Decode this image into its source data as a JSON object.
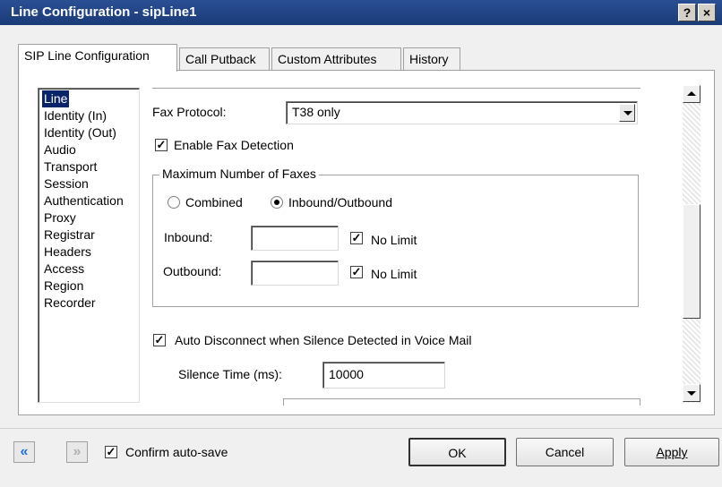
{
  "window": {
    "title": "Line Configuration - sipLine1",
    "help": "?",
    "close": "×"
  },
  "tabs": [
    "SIP Line Configuration",
    "Call Putback",
    "Custom Attributes",
    "History"
  ],
  "nav": [
    "Line",
    "Identity (In)",
    "Identity (Out)",
    "Audio",
    "Transport",
    "Session",
    "Authentication",
    "Proxy",
    "Registrar",
    "Headers",
    "Access",
    "Region",
    "Recorder"
  ],
  "form": {
    "fax_protocol_label": "Fax Protocol:",
    "fax_protocol_value": "T38 only",
    "enable_fax_detection": "Enable Fax Detection",
    "max_faxes_group": "Maximum Number of Faxes",
    "combined": "Combined",
    "inbound_outbound": "Inbound/Outbound",
    "inbound_label": "Inbound:",
    "outbound_label": "Outbound:",
    "inbound_value": "",
    "outbound_value": "",
    "no_limit": "No Limit",
    "auto_disconnect": "Auto Disconnect when Silence Detected in Voice Mail",
    "silence_time_label": "Silence Time (ms):",
    "silence_time_value": "10000"
  },
  "footer": {
    "back": "«",
    "forward": "»",
    "confirm_autosave": "Confirm auto-save",
    "ok": "OK",
    "cancel": "Cancel",
    "apply": "Apply"
  },
  "colors": {
    "titlebar": "#1f4286",
    "selection": "#0a246a",
    "back_arrow": "#1c6fd8"
  }
}
